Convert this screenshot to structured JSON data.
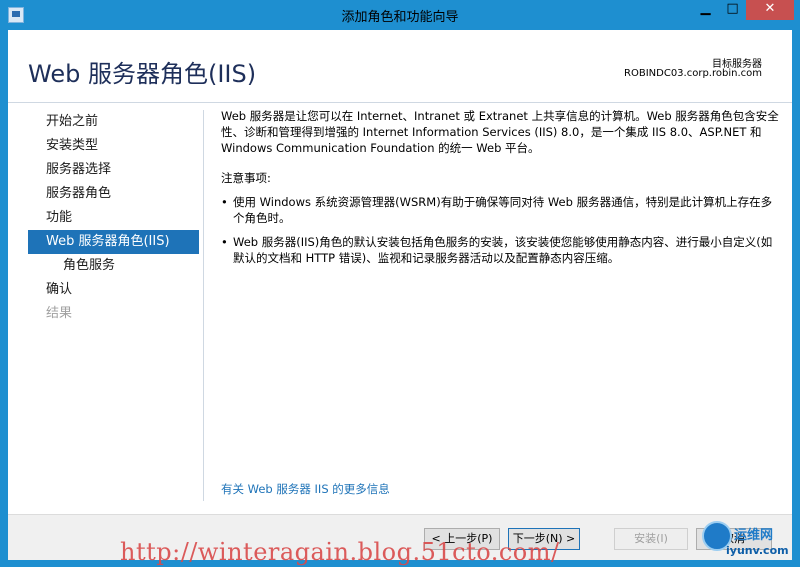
{
  "window": {
    "title": "添加角色和功能向导",
    "controls": {
      "minimize": "▁",
      "maximize": "□",
      "close": "✕"
    }
  },
  "header": {
    "page_title": "Web 服务器角色(IIS)",
    "target_label": "目标服务器",
    "target_server": "ROBINDC03.corp.robin.com"
  },
  "nav": {
    "items": [
      {
        "label": "开始之前",
        "state": "normal"
      },
      {
        "label": "安装类型",
        "state": "normal"
      },
      {
        "label": "服务器选择",
        "state": "normal"
      },
      {
        "label": "服务器角色",
        "state": "normal"
      },
      {
        "label": "功能",
        "state": "normal"
      },
      {
        "label": "Web 服务器角色(IIS)",
        "state": "active"
      },
      {
        "label": "角色服务",
        "state": "sub"
      },
      {
        "label": "确认",
        "state": "normal"
      },
      {
        "label": "结果",
        "state": "disabled"
      }
    ]
  },
  "content": {
    "intro": "Web 服务器是让您可以在 Internet、Intranet 或 Extranet 上共享信息的计算机。Web 服务器角色包含安全性、诊断和管理得到增强的 Internet Information Services (IIS) 8.0，是一个集成 IIS 8.0、ASP.NET 和 Windows Communication Foundation 的统一 Web 平台。",
    "notes_title": "注意事项:",
    "bullets": [
      "使用 Windows 系统资源管理器(WSRM)有助于确保等同对待 Web 服务器通信，特别是此计算机上存在多个角色时。",
      "Web 服务器(IIS)角色的默认安装包括角色服务的安装，该安装使您能够使用静态内容、进行最小自定义(如默认的文档和 HTTP 错误)、监视和记录服务器活动以及配置静态内容压缩。"
    ],
    "more_info_link": "有关 Web 服务器 IIS 的更多信息"
  },
  "footer": {
    "prev_label": "< 上一步(P)",
    "next_label": "下一步(N) >",
    "install_label": "安装(I)",
    "cancel_label": "取消"
  },
  "overlay": {
    "watermark": "http://winteragain.blog.51cto.com/",
    "logo_cn": "运维网",
    "logo_en": "iyunv.com"
  },
  "colors": {
    "accent": "#1e73b8",
    "titlebar": "#1e8fd0",
    "close": "#c75050"
  }
}
